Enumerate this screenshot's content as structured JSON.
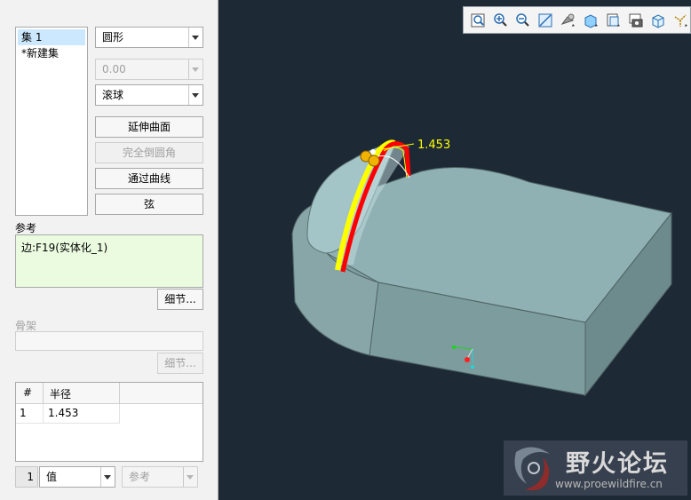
{
  "sets": {
    "items": [
      "集 1",
      "*新建集"
    ],
    "selected_index": 0
  },
  "shape_combo": "圆形",
  "value_combo": "0.00",
  "method_combo": "滚球",
  "buttons": {
    "extend_surface": "延伸曲面",
    "full_round": "完全倒圆角",
    "through_curve": "通过曲线",
    "chord": "弦"
  },
  "references": {
    "label": "参考",
    "item": "边:F19(实体化_1)",
    "details_button": "细节..."
  },
  "skeleton": {
    "label": "骨架",
    "details_button": "细节..."
  },
  "radius_table": {
    "headers": [
      "#",
      "半径"
    ],
    "rows": [
      [
        "1",
        "1.453"
      ]
    ]
  },
  "bottom": {
    "index": "1",
    "value_combo": "值",
    "reference_combo": "参考"
  },
  "viewport": {
    "dimension_label": "1.453",
    "toolbar_icons": [
      "zoom-fit-icon",
      "zoom-in-icon",
      "zoom-out-icon",
      "repaint-icon",
      "spin-center-icon",
      "display-style-icon",
      "saved-views-icon",
      "layers-icon",
      "view-manager-icon",
      "datum-display-icon"
    ]
  },
  "watermark": {
    "title": "野火论坛",
    "url": "www.proewildfire.cn"
  },
  "colors": {
    "model_fill": "#8fb1b3",
    "background": "#1e2936",
    "highlight_red": "#ff0000",
    "highlight_yellow": "#ffff00",
    "reference_bg": "#ebfbe0"
  }
}
